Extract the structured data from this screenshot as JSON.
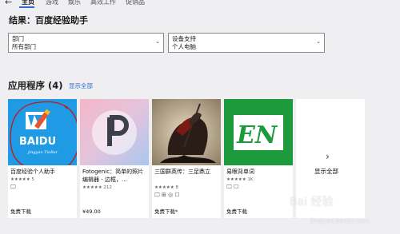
{
  "nav": {
    "back_icon": "back-arrow-icon",
    "tabs": [
      "主页",
      "游戏",
      "娱乐",
      "高效工作",
      "促销品"
    ]
  },
  "results_title": "结果：百度经验助手",
  "filters": [
    {
      "label": "部门",
      "value": "所有部门"
    },
    {
      "label": "设备支持",
      "value": "个人电脑"
    }
  ],
  "apps_section": {
    "title": "应用程序 (4)",
    "show_all": "显示全部"
  },
  "apps": [
    {
      "name": "百度经验个人助手",
      "rating": "★★★★★ 5",
      "device": "🖵",
      "price": "免费下载",
      "art": "baidu"
    },
    {
      "name": "Fotogenic：简单的照片编辑器 - 边框，...",
      "rating": "★★★★★ 212",
      "device": "🖵",
      "price": "¥49.00",
      "art": "fotogenic"
    },
    {
      "name": "三国群英传：三足鼎立",
      "rating": "★★★★★ 8",
      "device": "🖵 ⊞ ◎ ☐",
      "price": "免费下载*",
      "art": "sanguo"
    },
    {
      "name": "易眼背单词",
      "rating": "★★★★★ 1K",
      "device": "🖵 ☐",
      "price": "免费下载",
      "art": "en"
    }
  ],
  "show_all_card": "显示全部",
  "colors": {
    "accent": "#2b6ad1",
    "annotation": "#c0181b",
    "en_green": "#1d9a3c"
  },
  "watermark": {
    "main": "Bai 经验",
    "sub": "jingyan.baidu.com"
  }
}
